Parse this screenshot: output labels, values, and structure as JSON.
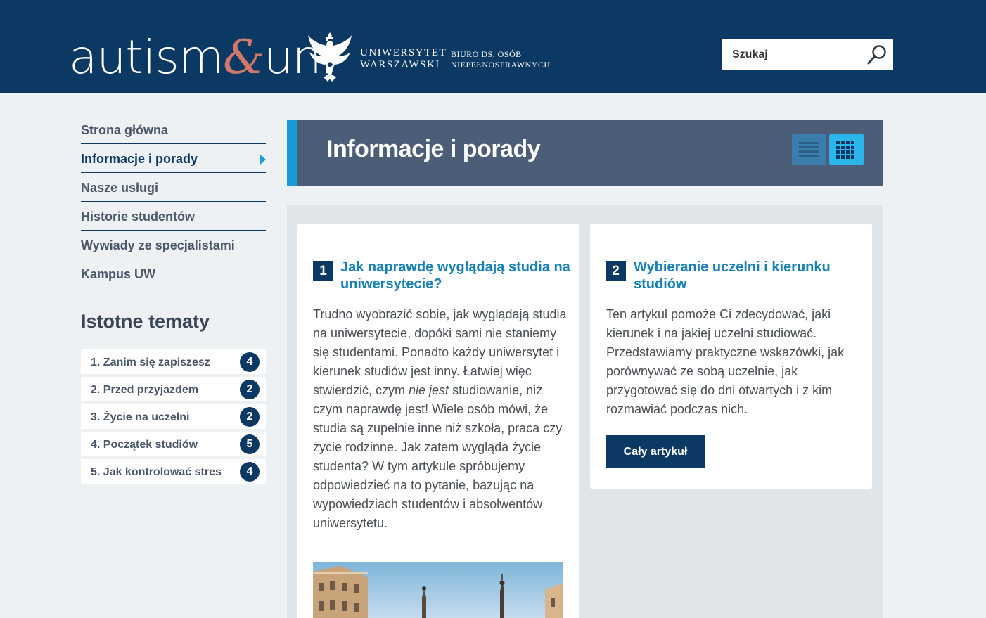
{
  "header": {
    "logo_main": "autism",
    "logo_amp": "&",
    "logo_end": "uni",
    "university_line1": "UNIWERSYTET",
    "university_line2": "WARSZAWSKI",
    "office_line1": "BIURO DS. OSÓB",
    "office_line2": "NIEPEŁNOSPRAWNYCH",
    "search_placeholder": "Szukaj",
    "search_icon": "search-icon"
  },
  "nav": {
    "items": [
      {
        "label": "Strona główna"
      },
      {
        "label": "Informacje i porady",
        "active": true
      },
      {
        "label": "Nasze usługi"
      },
      {
        "label": "Historie studentów"
      },
      {
        "label": "Wywiady ze specjalistami"
      },
      {
        "label": "Kampus UW"
      }
    ]
  },
  "topics": {
    "title": "Istotne tematy",
    "items": [
      {
        "label": "1. Zanim się zapiszesz",
        "count": "4"
      },
      {
        "label": "2. Przed przyjazdem",
        "count": "2"
      },
      {
        "label": "3. Życie na uczelni",
        "count": "2"
      },
      {
        "label": "4. Początek studiów",
        "count": "5"
      },
      {
        "label": "5. Jak kontrolować stres",
        "count": "4"
      }
    ]
  },
  "main": {
    "title": "Informacje i porady",
    "view_list_icon": "list-view-icon",
    "view_grid_icon": "grid-view-icon",
    "articles": [
      {
        "number": "1",
        "title_line1": "Jak naprawdę wyglądają studia na",
        "title_line2": "uniwersytecie?",
        "text_lines": [
          "Trudno wyobrazić sobie, jak wyglądają studia",
          "na uniwersytecie, dopóki sami nie staniemy",
          "się studentami. Ponadto każdy uniwersytet i",
          "kierunek studiów jest inny. Łatwiej więc",
          "studiowanie, niż",
          "czym naprawdę jest! Wiele osób mówi, że",
          "studia są zupełnie inne niż szkoła, praca czy",
          "życie rodzinne. Jak zatem wygląda życie",
          "studenta? W tym artykule spróbujemy",
          "odpowiedzieć na to pytanie, bazując na",
          "wypowiedziach studentów i absolwentów",
          "uniwersytetu."
        ],
        "line5_start": "stwierdzić, czym ",
        "line5_em": "nie jest"
      },
      {
        "number": "2",
        "title_line1": "Wybieranie uczelni i kierunku",
        "title_line2": "studiów",
        "text_lines": [
          "Ten artykuł pomoże Ci zdecydować, jaki",
          "kierunek i na jakiej uczelni studiować.",
          "Przedstawiamy praktyczne wskazówki, jak",
          "porównywać ze sobą uczelnie, jak",
          "przygotować się do dni otwartych i z kim",
          "rozmawiać podczas nich."
        ],
        "button": "Cały artykuł"
      }
    ]
  },
  "colors": {
    "header_bg": "#0c3963",
    "accent_blue": "#1a9ad6",
    "banner_bg": "#4c5d78",
    "link_blue": "#1680b8",
    "logo_amp": "#d2776a"
  }
}
